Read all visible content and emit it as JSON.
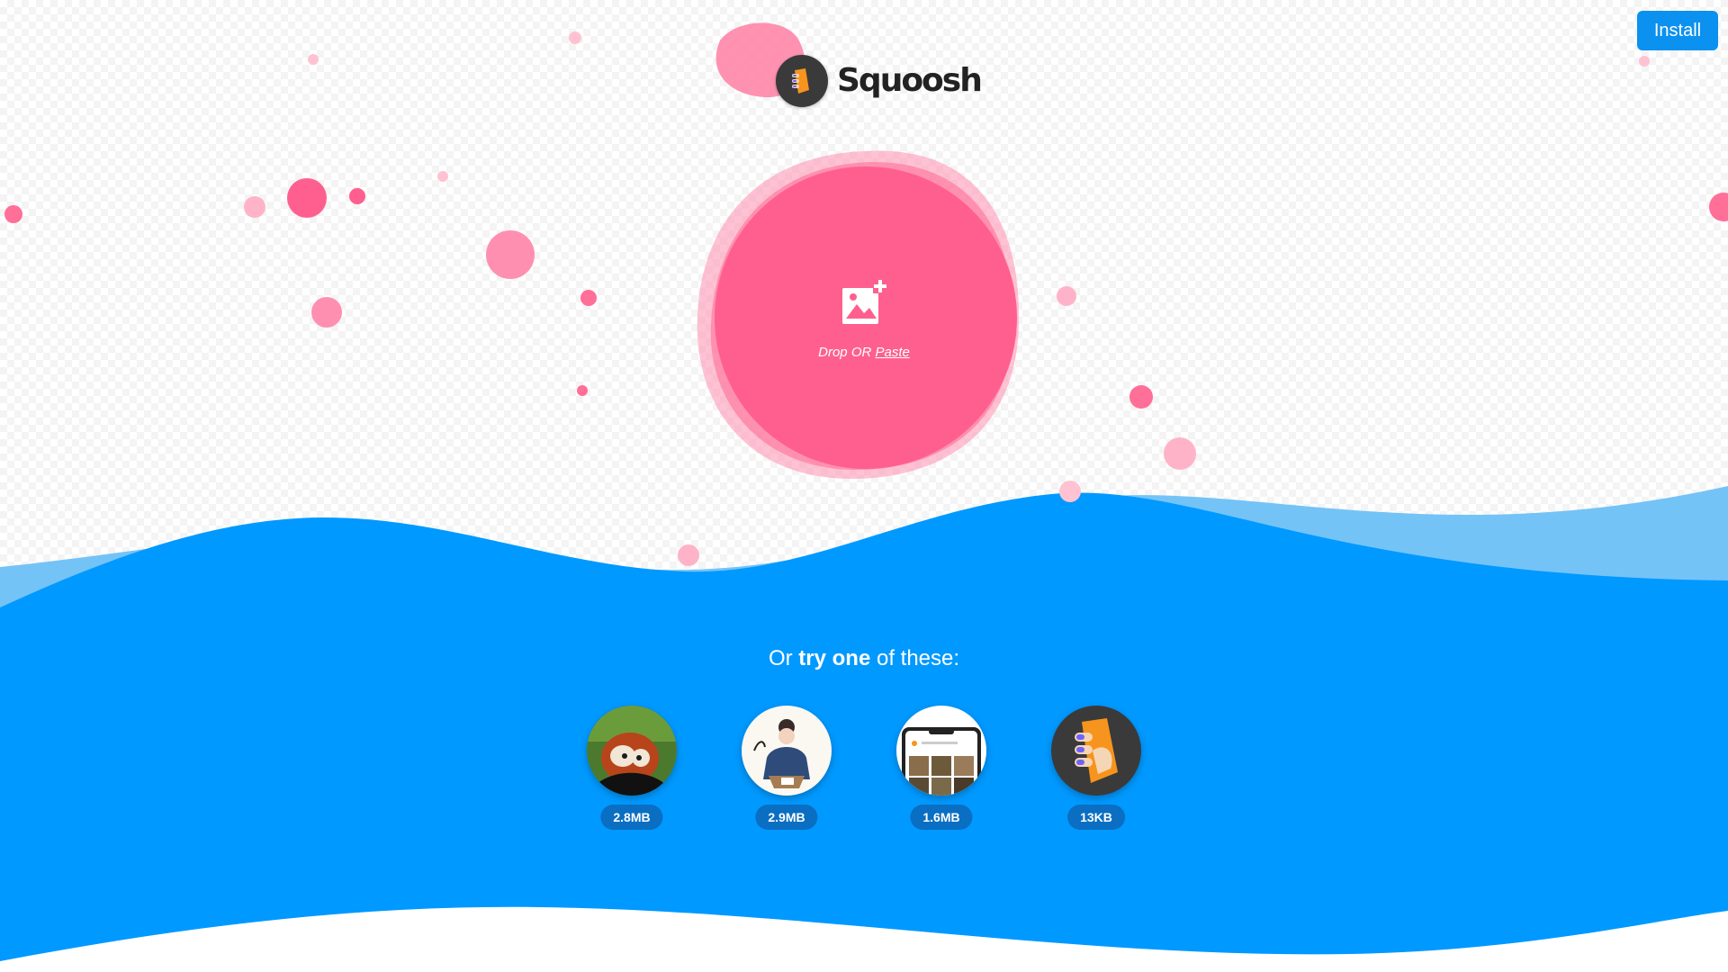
{
  "app": {
    "name": "Squoosh"
  },
  "header": {
    "install_label": "Install"
  },
  "drop_zone": {
    "drop_label": "Drop",
    "or_label": "OR",
    "paste_label": "Paste"
  },
  "demos": {
    "heading_pre": "Or ",
    "heading_bold1": "try",
    "heading_bold2": "one",
    "heading_post": " of these:",
    "items": [
      {
        "size": "2.8MB",
        "icon": "red-panda-photo"
      },
      {
        "size": "2.9MB",
        "icon": "illustration-artwork"
      },
      {
        "size": "1.6MB",
        "icon": "device-screenshot"
      },
      {
        "size": "13KB",
        "icon": "squoosh-logo-vector"
      }
    ]
  },
  "colors": {
    "accent_blue": "#0b91ef",
    "wave_blue": "#0099ff",
    "wave_light": "#74c3f7",
    "blob_pink": "#ff5f8e",
    "blob_light": "#ff92b0",
    "text_dark": "#222222"
  }
}
